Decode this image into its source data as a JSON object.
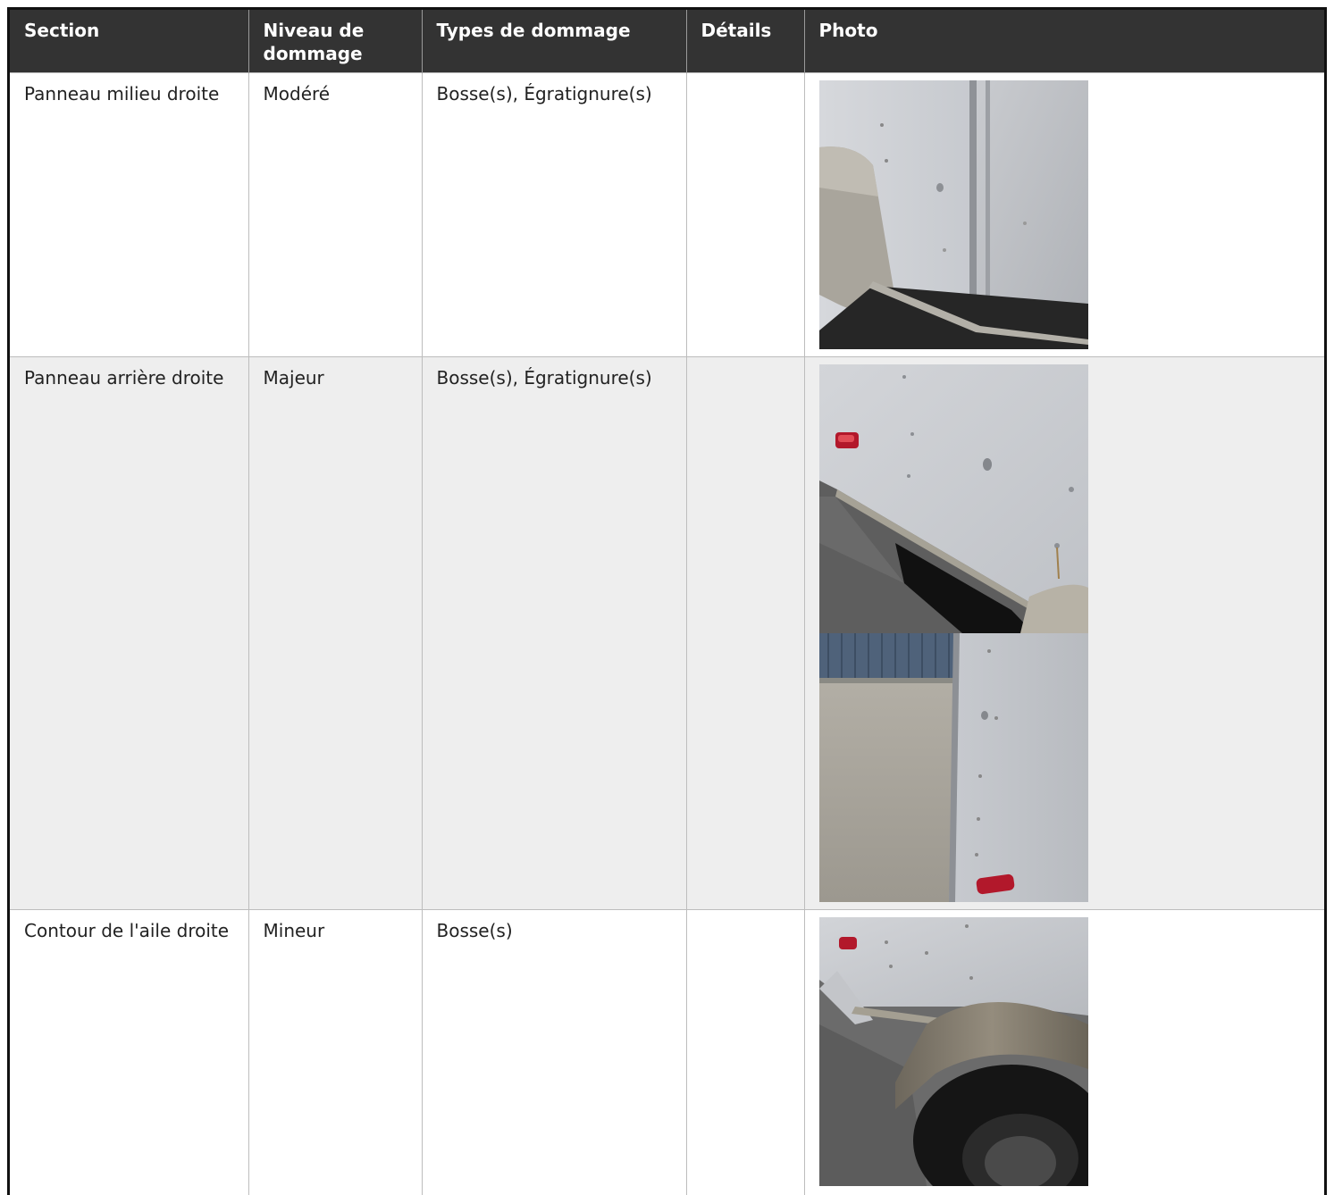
{
  "table": {
    "headers": {
      "section": "Section",
      "niveau": "Niveau de dommage",
      "types": "Types de dommage",
      "details": "Détails",
      "photo": "Photo"
    },
    "rows": [
      {
        "section": "Panneau milieu droite",
        "niveau": "Modéré",
        "types": "Bosse(s), Égratignure(s)",
        "details": "",
        "photos": [
          "photo-trailer-middle-panel-dents"
        ]
      },
      {
        "section": "Panneau arrière droite",
        "niveau": "Majeur",
        "types": "Bosse(s), Égratignure(s)",
        "details": "",
        "photos": [
          "photo-trailer-rear-panel-dents",
          "photo-trailer-rear-corner-dents"
        ]
      },
      {
        "section": "Contour de l'aile droite",
        "niveau": "Mineur",
        "types": "Bosse(s)",
        "details": "",
        "photos": [
          "photo-trailer-fender-contour"
        ]
      }
    ]
  },
  "colors": {
    "header_bg": "#333333",
    "header_text": "#ffffff",
    "row_alt_bg": "#eeeeee",
    "border": "#bdbdbd"
  }
}
